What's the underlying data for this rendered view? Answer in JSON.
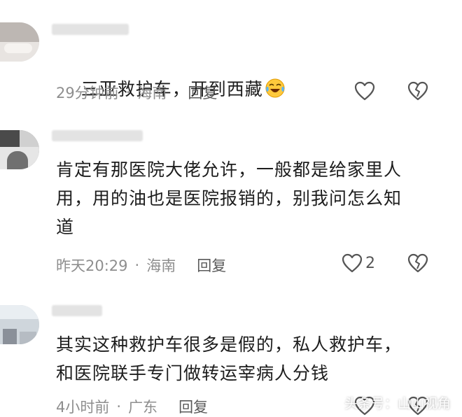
{
  "comments": [
    {
      "text": "三亚救护车，开到西藏",
      "emoji": "laughing-crying-emoji",
      "time": "29分钟前",
      "sep": "·",
      "location": "海南",
      "reply": "回复",
      "likes": ""
    },
    {
      "text": "肯定有那医院大佬允许，一般都是给家里人\n用，用的油也是医院报销的，别我问怎么知\n道",
      "time": "昨天20:29",
      "sep": "·",
      "location": "海南",
      "reply": "回复",
      "likes": "2"
    },
    {
      "text": "其实这种救护车很多是假的，私人救护车，\n和医院联手专门做转运宰病人分钱",
      "time": "4小时前",
      "sep": "·",
      "location": "广东",
      "reply": "回复",
      "likes": ""
    }
  ],
  "watermark": "头条号：山山视角",
  "colors": {
    "text": "#1d1d1d",
    "meta": "#8e8e8e",
    "icon": "#555555"
  }
}
